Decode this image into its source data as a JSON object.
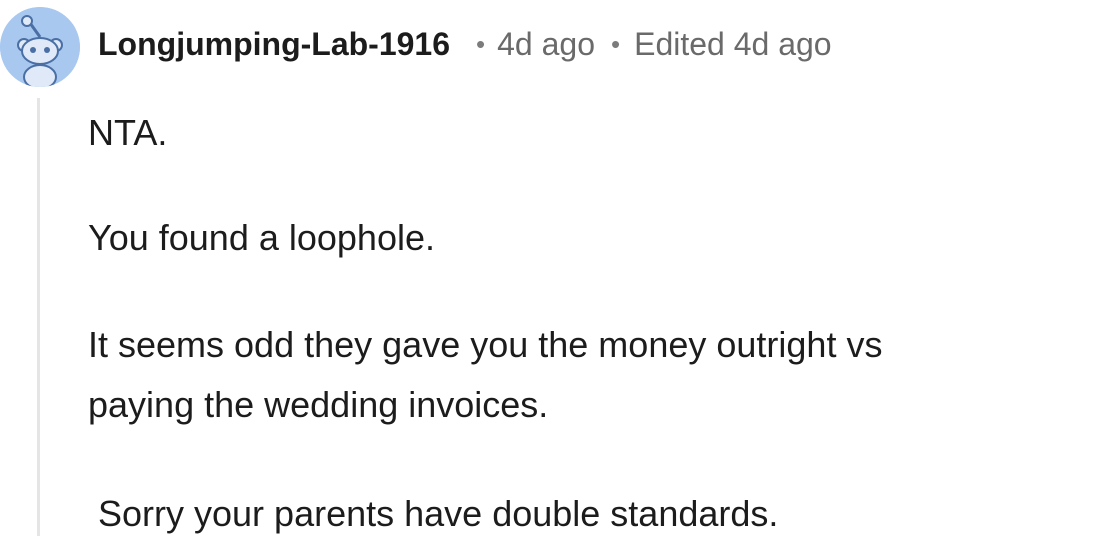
{
  "comment": {
    "author": "Longjumping-Lab-1916",
    "separator": "•",
    "posted": "4d ago",
    "edited": "Edited 4d ago",
    "avatar_icon": "snoo-avatar-icon",
    "avatar_color": "#a8c8f0",
    "paragraphs": [
      "NTA.",
      "You found a loophole.",
      "It seems odd they gave you the money outright vs",
      "paying the wedding invoices.",
      " Sorry your parents have double standards."
    ]
  }
}
